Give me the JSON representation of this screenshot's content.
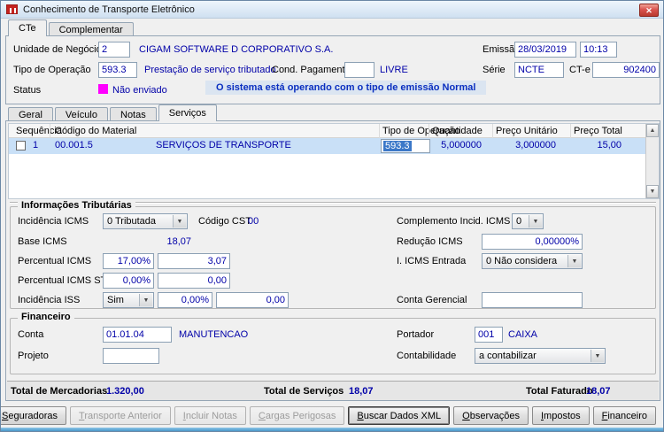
{
  "window": {
    "title": "Conhecimento de Transporte Eletrônico"
  },
  "colors": {
    "value_text": "#0000a8",
    "status_indicator": "#ff00ff",
    "selection": "#3b78c8",
    "row_highlight": "#c9e0f7"
  },
  "top_tabs": {
    "cte": "CTe",
    "complementar": "Complementar"
  },
  "header": {
    "unidade_label": "Unidade de Negócio",
    "unidade_value": "2",
    "unidade_desc": "CIGAM SOFTWARE D CORPORATIVO S.A.",
    "emissao_label": "Emissão",
    "emissao_date": "28/03/2019",
    "emissao_time": "10:13",
    "tipo_label": "Tipo de Operação",
    "tipo_value": "593.3",
    "tipo_desc": "Prestação de serviço tributado",
    "cond_label": "Cond. Pagamento",
    "cond_value": "",
    "cond_desc": "LIVRE",
    "serie_label": "Série",
    "serie_value": "NCTE",
    "cte_label": "CT-e",
    "cte_value": "902400",
    "status_label": "Status",
    "status_value": "Não enviado",
    "system_message": "O sistema está operando com o tipo de emissão Normal"
  },
  "mid_tabs": {
    "geral": "Geral",
    "veiculo": "Veículo",
    "notas": "Notas",
    "servicos": "Serviços"
  },
  "table": {
    "headers": {
      "sequencia": "Sequência",
      "codigo": "Código do Material",
      "tipo": "Tipo de Operação",
      "quantidade": "Quantidade",
      "preco_unit": "Preço Unitário",
      "preco_total": "Preço Total"
    },
    "row": {
      "seq": "1",
      "codigo": "00.001.5",
      "material": "SERVIÇOS DE TRANSPORTE",
      "tipo": "593.3",
      "quantidade": "5,000000",
      "preco_unit": "3,000000",
      "preco_total": "15,00"
    }
  },
  "tributarias": {
    "title": "Informações Tributárias",
    "incidencia_icms_label": "Incidência ICMS",
    "incidencia_icms_value": "0 Tributada",
    "codigo_cst_label": "Código CST",
    "codigo_cst_value": "00",
    "complemento_label": "Complemento Incid. ICMS",
    "complemento_value": "0",
    "base_icms_label": "Base ICMS",
    "base_icms_value": "18,07",
    "reducao_label": "Redução ICMS",
    "reducao_value": "0,00000%",
    "percentual_icms_label": "Percentual ICMS",
    "percentual_icms_pct": "17,00%",
    "percentual_icms_valor": "3,07",
    "icms_entrada_label": "I. ICMS Entrada",
    "icms_entrada_value": "0 Não considera",
    "percentual_icms_st_label": "Percentual ICMS ST",
    "percentual_icms_st_pct": "0,00%",
    "percentual_icms_st_valor": "0,00",
    "incidencia_iss_label": "Incidência ISS",
    "incidencia_iss_value": "Sim",
    "iss_pct": "0,00%",
    "iss_valor": "0,00",
    "conta_gerencial_label": "Conta Gerencial",
    "conta_gerencial_value": ""
  },
  "financeiro": {
    "title": "Financeiro",
    "conta_label": "Conta",
    "conta_value": "01.01.04",
    "conta_desc": "MANUTENCAO",
    "portador_label": "Portador",
    "portador_value": "001",
    "portador_desc": "CAIXA",
    "projeto_label": "Projeto",
    "projeto_value": "",
    "contabilidade_label": "Contabilidade",
    "contabilidade_value": "a contabilizar"
  },
  "totals": {
    "mercadorias_label": "Total de Mercadorias",
    "mercadorias_value": "1.320,00",
    "servicos_label": "Total de Serviços",
    "servicos_value": "18,07",
    "faturado_label": "Total Faturado",
    "faturado_value": "18,07"
  },
  "buttons": [
    {
      "label": "Seguradoras"
    },
    {
      "label": "Transporte Anterior"
    },
    {
      "label": "Incluir Notas"
    },
    {
      "label": "Cargas Perigosas"
    },
    {
      "label": "Buscar Dados XML"
    },
    {
      "label": "Observações"
    },
    {
      "label": "Impostos"
    },
    {
      "label": "Financeiro"
    }
  ]
}
